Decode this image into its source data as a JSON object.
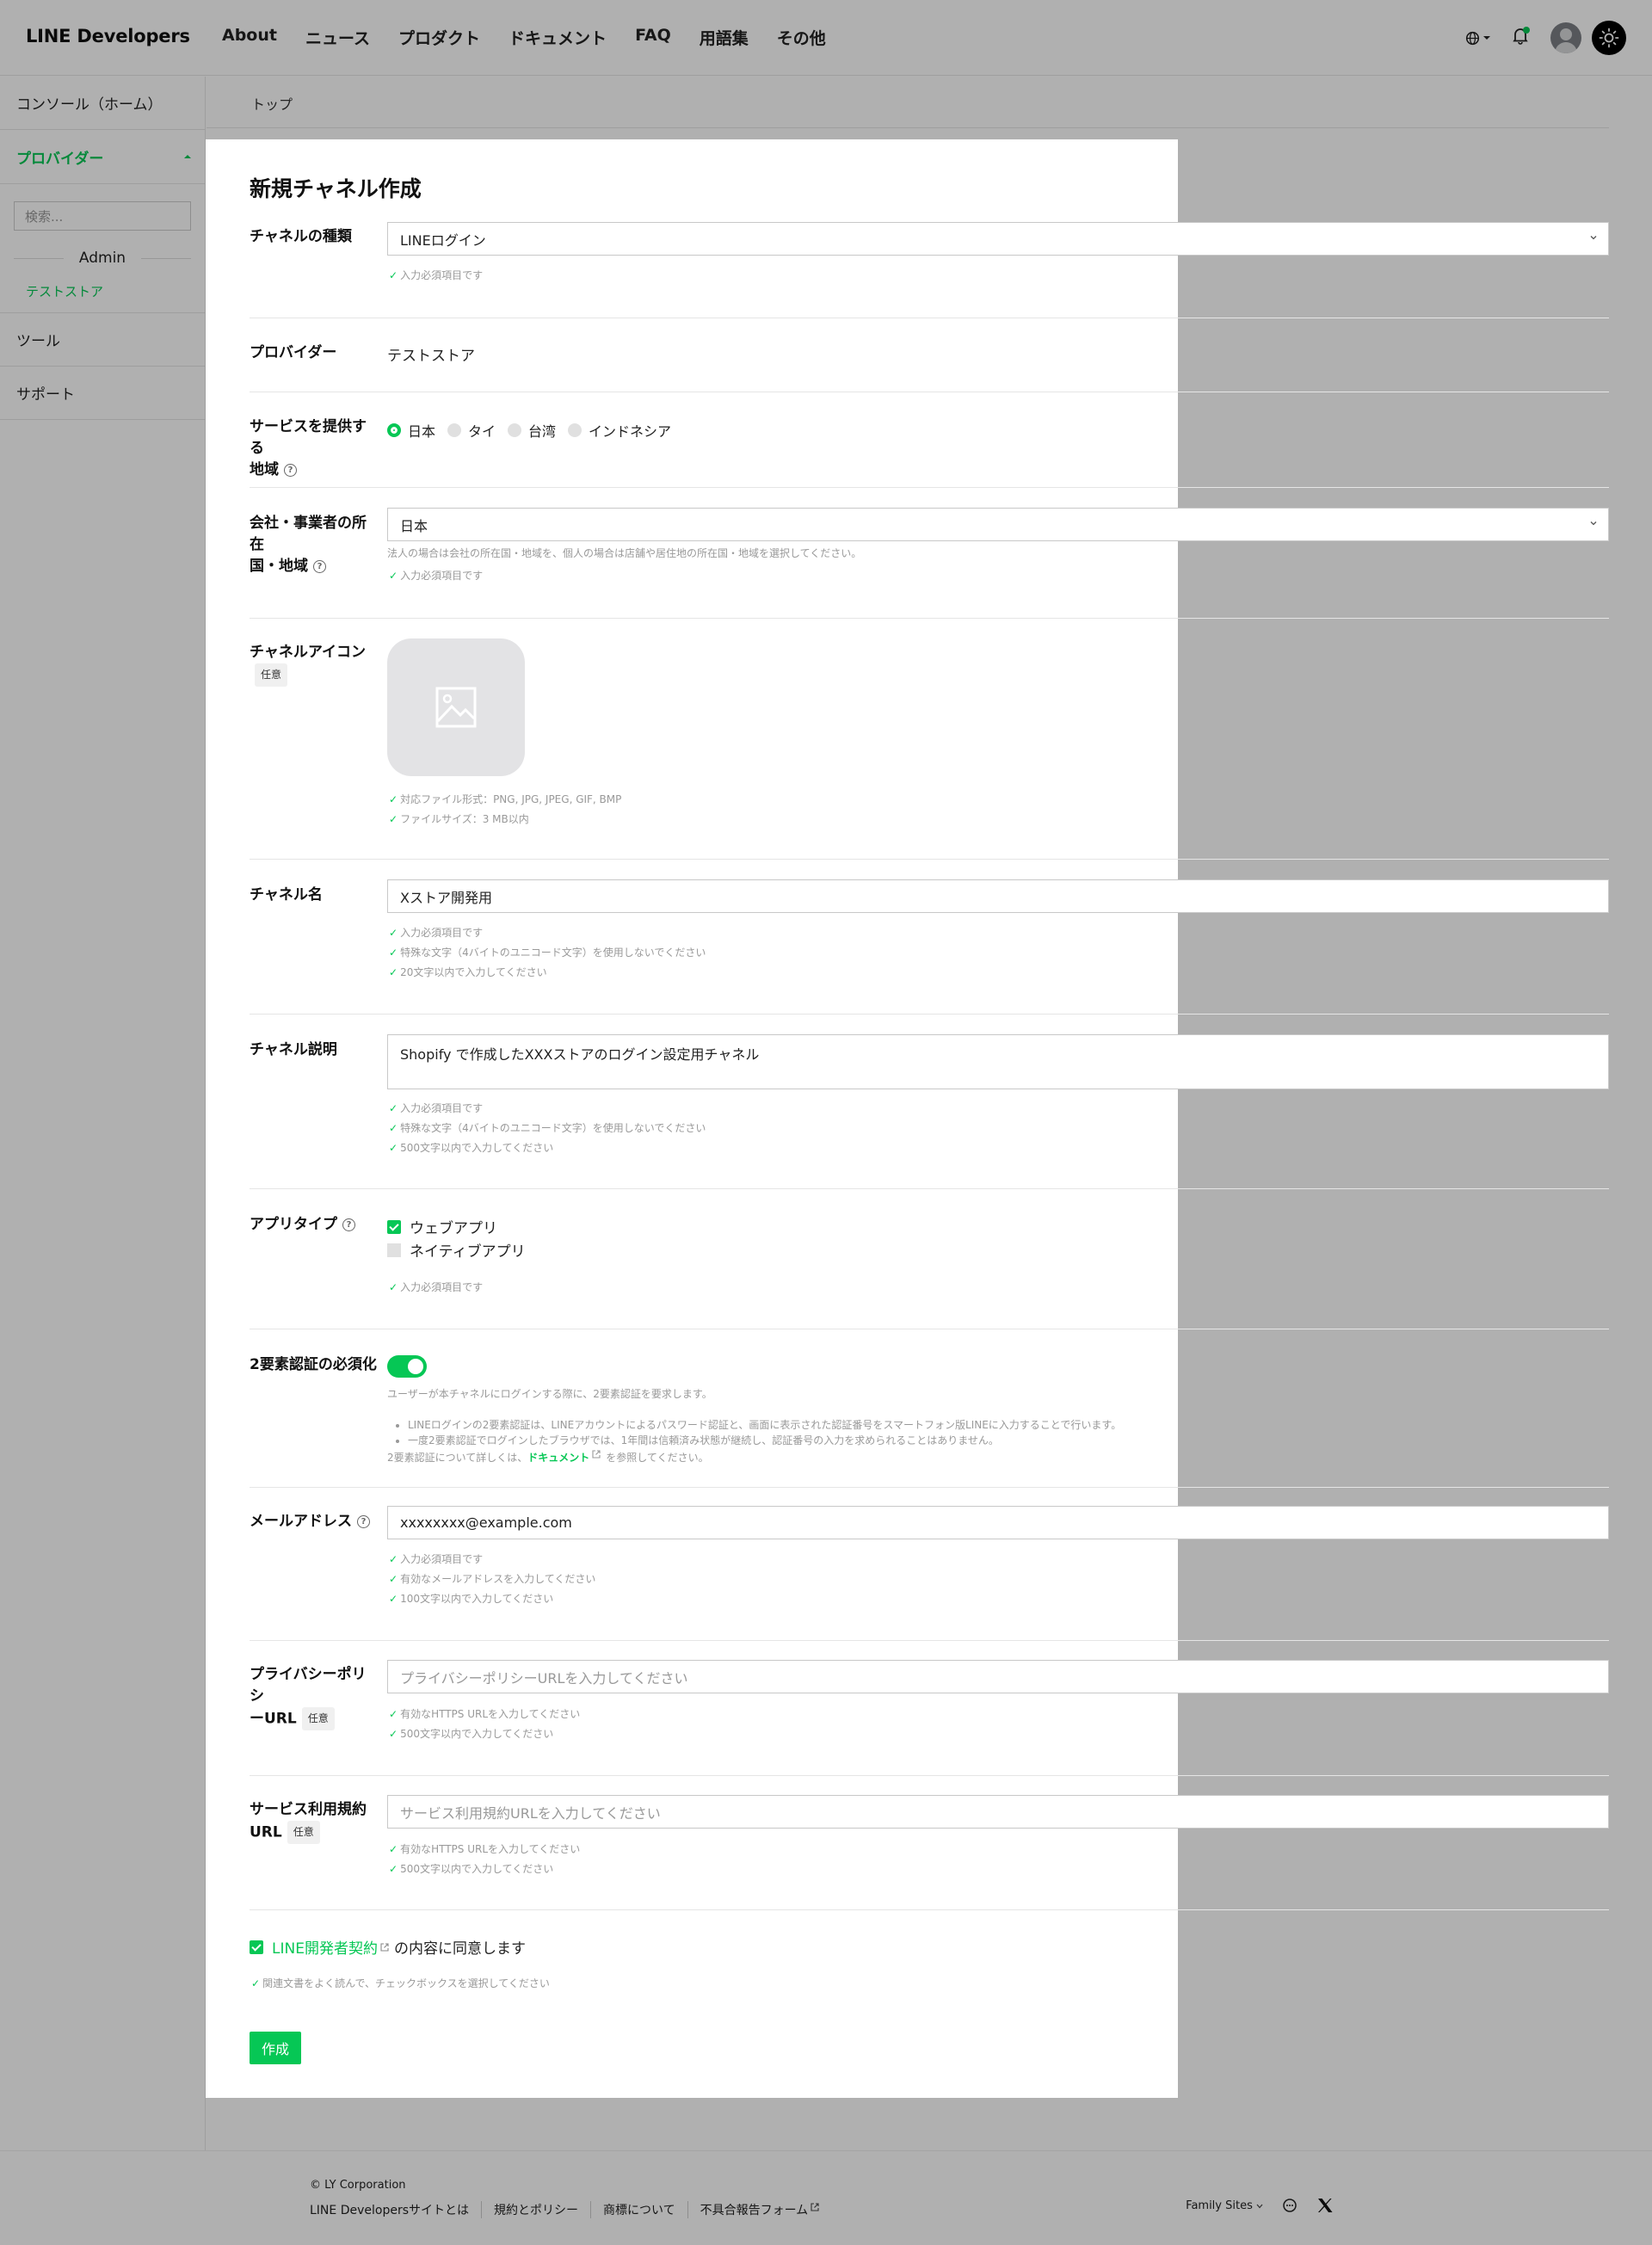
{
  "header": {
    "logo": "LINE Developers",
    "nav": [
      "About",
      "ニュース",
      "プロダクト",
      "ドキュメント",
      "FAQ",
      "用語集",
      "その他"
    ]
  },
  "sidebar": {
    "console_home": "コンソール（ホーム）",
    "provider": "プロバイダー",
    "search_placeholder": "検索...",
    "admin": "Admin",
    "store": "テストストア",
    "tools": "ツール",
    "support": "サポート"
  },
  "breadcrumb": "トップ",
  "modal": {
    "title": "新規チャネル作成",
    "channel_type": {
      "label": "チャネルの種類",
      "value": "LINEログイン",
      "note": "入力必須項目です"
    },
    "provider": {
      "label": "プロバイダー",
      "value": "テストストア"
    },
    "region": {
      "label_line1": "サービスを提供する",
      "label_line2": "地域",
      "options": [
        "日本",
        "タイ",
        "台湾",
        "インドネシア"
      ],
      "selected": "日本"
    },
    "company_country": {
      "label_line1": "会社・事業者の所在",
      "label_line2": "国・地域",
      "value": "日本",
      "description": "法人の場合は会社の所在国・地域を、個人の場合は店舗や居住地の所在国・地域を選択してください。",
      "note": "入力必須項目です"
    },
    "channel_icon": {
      "label": "チャネルアイコン",
      "optional": "任意",
      "notes": [
        "対応ファイル形式：PNG, JPG, JPEG, GIF, BMP",
        "ファイルサイズ：3 MB以内"
      ]
    },
    "channel_name": {
      "label": "チャネル名",
      "value": "Xストア開発用",
      "notes": [
        "入力必須項目です",
        "特殊な文字（4バイトのユニコード文字）を使用しないでください",
        "20文字以内で入力してください"
      ]
    },
    "channel_description": {
      "label": "チャネル説明",
      "value": "Shopify で作成したXXXストアのログイン設定用チャネル",
      "notes": [
        "入力必須項目です",
        "特殊な文字（4バイトのユニコード文字）を使用しないでください",
        "500文字以内で入力してください"
      ]
    },
    "app_type": {
      "label": "アプリタイプ",
      "options": [
        {
          "label": "ウェブアプリ",
          "checked": true
        },
        {
          "label": "ネイティブアプリ",
          "checked": false
        }
      ],
      "note": "入力必須項目です"
    },
    "two_factor": {
      "label": "2要素認証の必須化",
      "enabled": true,
      "description": "ユーザーが本チャネルにログインする際に、2要素認証を要求します。",
      "bullets": [
        "LINEログインの2要素認証は、LINEアカウントによるパスワード認証と、画面に表示された認証番号をスマートフォン版LINEに入力することで行います。",
        "一度2要素認証でログインしたブラウザでは、1年間は信頼済み状態が継続し、認証番号の入力を求められることはありません。"
      ],
      "doc_prefix": "2要素認証について詳しくは、",
      "doc_link": "ドキュメント",
      "doc_suffix": "を参照してください。"
    },
    "email": {
      "label": "メールアドレス",
      "value": "xxxxxxxx@example.com",
      "notes": [
        "入力必須項目です",
        "有効なメールアドレスを入力してください",
        "100文字以内で入力してください"
      ]
    },
    "privacy_url": {
      "label_line1": "プライバシーポリシ",
      "label_line2": "ーURL",
      "optional": "任意",
      "placeholder": "プライバシーポリシーURLを入力してください",
      "notes": [
        "有効なHTTPS URLを入力してください",
        "500文字以内で入力してください"
      ]
    },
    "terms_url": {
      "label_line1": "サービス利用規約",
      "label_line2": "URL",
      "optional": "任意",
      "placeholder": "サービス利用規約URLを入力してください",
      "notes": [
        "有効なHTTPS URLを入力してください",
        "500文字以内で入力してください"
      ]
    },
    "agreement": {
      "link": "LINE開発者契約",
      "suffix": "の内容に同意します",
      "note": "関連文書をよく読んで、チェックボックスを選択してください"
    },
    "create_button": "作成"
  },
  "footer": {
    "copyright": "© LY Corporation",
    "links": [
      "LINE Developersサイトとは",
      "規約とポリシー",
      "商標について",
      "不具合報告フォーム"
    ],
    "family_sites": "Family Sites"
  },
  "colors": {
    "accent": "#06c755",
    "overlay": "rgba(0,0,0,0.31)"
  }
}
